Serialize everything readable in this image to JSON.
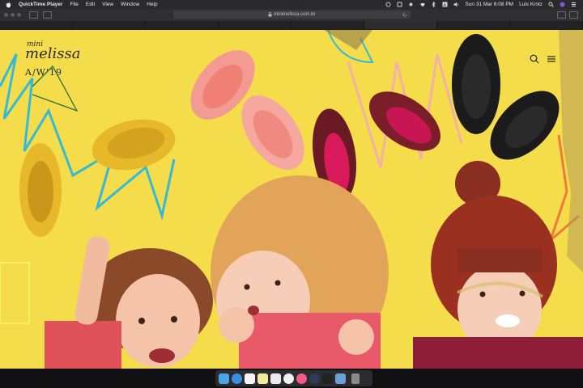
{
  "menubar": {
    "app_name": "QuickTime Player",
    "menus": [
      "File",
      "Edit",
      "View",
      "Window",
      "Help"
    ],
    "date_time": "Sun 31 Mar  6:08 PM",
    "user": "Luis Krotz"
  },
  "browser": {
    "url": "minimelissa.com.br",
    "tabs": [
      "",
      "",
      "",
      "",
      "",
      "",
      "",
      ""
    ]
  },
  "page": {
    "logo_mini": "mini",
    "logo_melissa": "melissa",
    "season": "A/W'19"
  },
  "colors": {
    "background_yellow": "#f4dc4a",
    "shoe_yellow": "#e6b82a",
    "shoe_pink": "#f39a92",
    "shoe_glitter_red": "#7a1f2a",
    "shoe_black": "#1b1b1b",
    "scribble_cyan": "#34b9d6",
    "scribble_orange": "#f07a3a"
  },
  "dock": {
    "apps": [
      "finder-icon",
      "safari-icon",
      "calendar-icon",
      "notes-icon",
      "textedit-icon",
      "photos-icon",
      "itunes-icon",
      "quicktime-icon",
      "terminal-icon",
      "preview-icon",
      "trash-icon"
    ]
  }
}
